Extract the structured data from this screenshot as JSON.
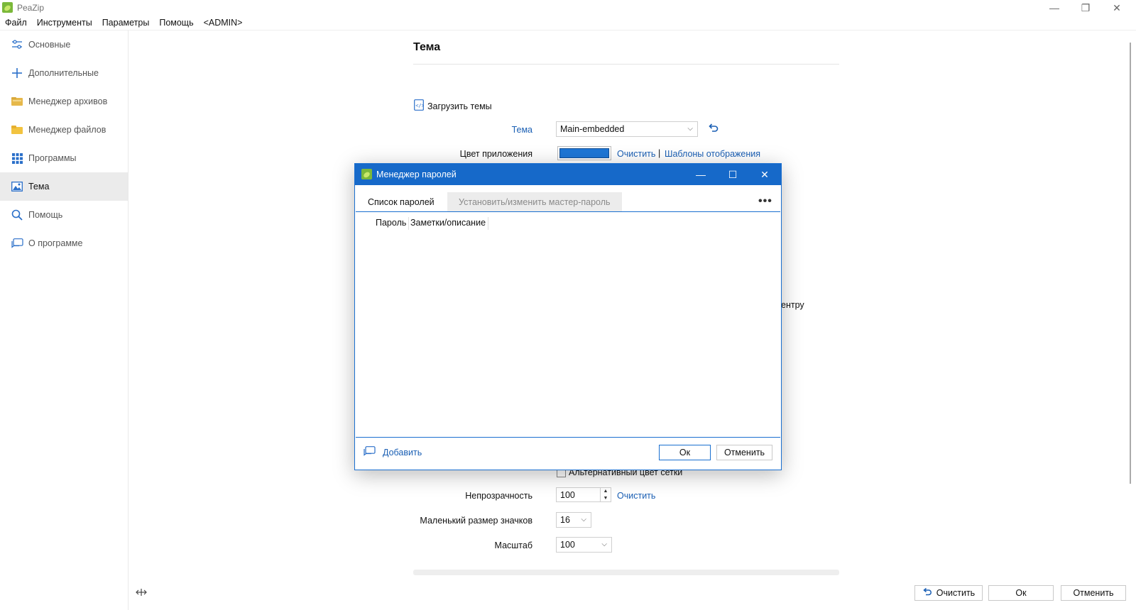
{
  "app": {
    "title": "PeaZip"
  },
  "menu": [
    "Файл",
    "Инструменты",
    "Параметры",
    "Помощь",
    "<ADMIN>"
  ],
  "sidebar": {
    "items": [
      {
        "label": "Основные",
        "icon": "sliders-icon"
      },
      {
        "label": "Дополнительные",
        "icon": "plus-icon"
      },
      {
        "label": "Менеджер архивов",
        "icon": "archive-folder-icon"
      },
      {
        "label": "Менеджер файлов",
        "icon": "folder-icon"
      },
      {
        "label": "Программы",
        "icon": "grid-icon"
      },
      {
        "label": "Тема",
        "icon": "image-icon",
        "active": true
      },
      {
        "label": "Помощь",
        "icon": "search-icon"
      },
      {
        "label": "О программе",
        "icon": "chat-icon"
      }
    ]
  },
  "main": {
    "title": "Тема",
    "load_themes": "Загрузить темы",
    "theme_label": "Тема",
    "theme_value": "Main-embedded",
    "app_color_label": "Цвет приложения",
    "app_color": "#1e76d6",
    "clear": "Очистить",
    "separator": "|",
    "display_templates": "Шаблоны отображения",
    "partial_text": "ентру",
    "alt_grid_label": "Альтернативный цвет сетки",
    "opacity_label": "Непрозрачность",
    "opacity_value": "100",
    "opacity_clear": "Очистить",
    "small_icon_label": "Маленький размер значков",
    "small_icon_value": "16",
    "scale_label": "Масштаб",
    "scale_value": "100"
  },
  "footer": {
    "clear": "Очистить",
    "ok": "Ок",
    "cancel": "Отменить"
  },
  "dialog": {
    "title": "Менеджер паролей",
    "tab_list": "Список паролей",
    "tab_master": "Установить/изменить мастер-пароль",
    "more": "•••",
    "columns": [
      "Пароль",
      "Заметки/описание"
    ],
    "add": "Добавить",
    "ok": "Ок",
    "cancel": "Отменить"
  },
  "colors": {
    "accent": "#1669c9",
    "link": "#1a5fb4"
  }
}
